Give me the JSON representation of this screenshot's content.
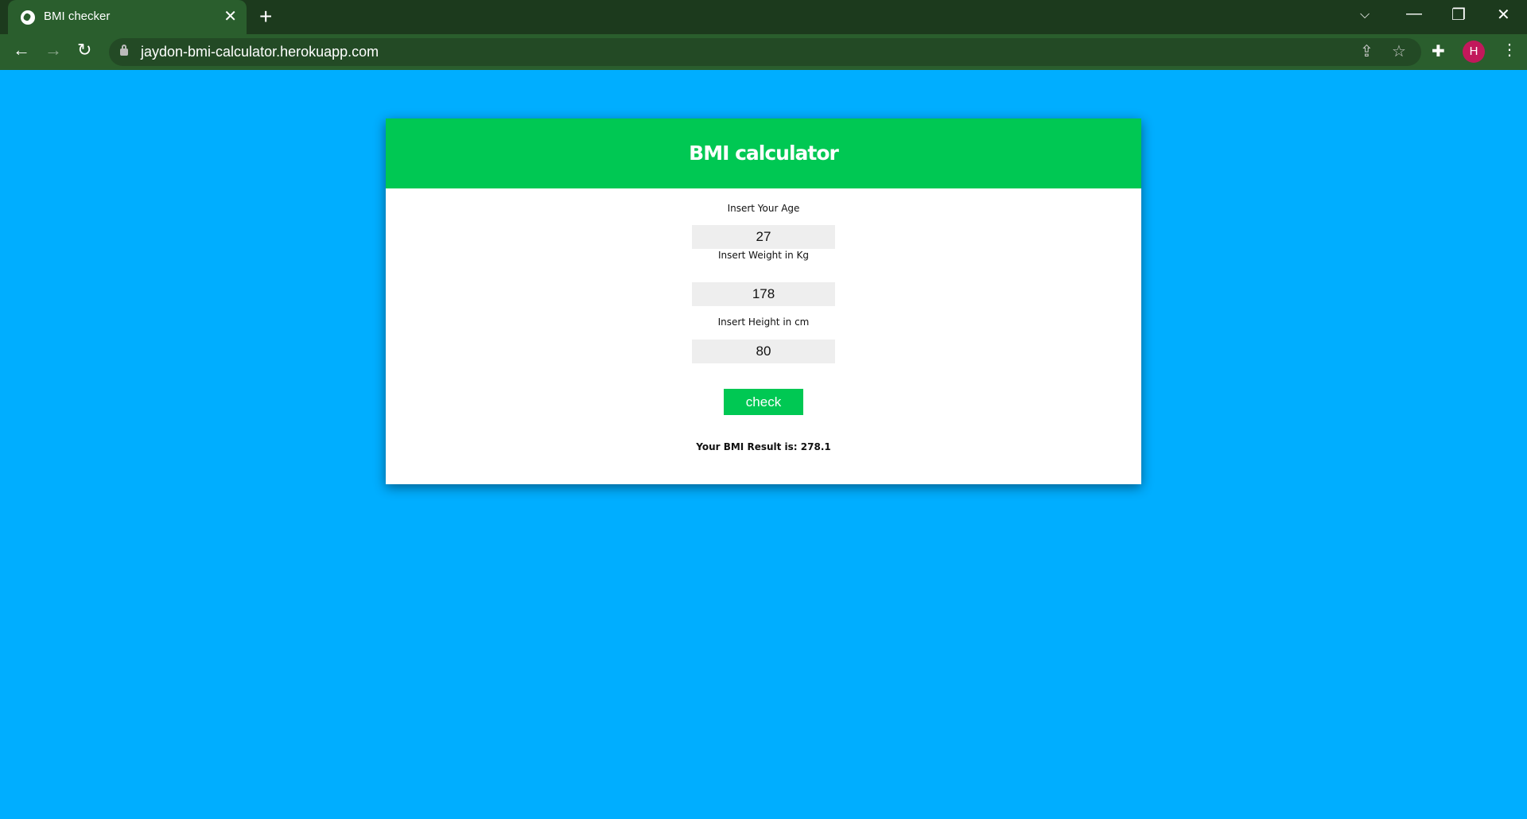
{
  "browser": {
    "tab_title": "BMI checker",
    "url": "jaydon-bmi-calculator.herokuapp.com",
    "profile_initial": "H"
  },
  "app": {
    "title": "BMI calculator",
    "fields": [
      {
        "label": "Insert Your Age",
        "value": "27"
      },
      {
        "label": "Insert Weight in Kg",
        "value": "178"
      },
      {
        "label": "Insert Height in cm",
        "value": "80"
      }
    ],
    "button_label": "check",
    "result": "Your BMI Result is: 278.1"
  },
  "colors": {
    "page_bg": "#00aeff",
    "accent": "#00c853"
  }
}
